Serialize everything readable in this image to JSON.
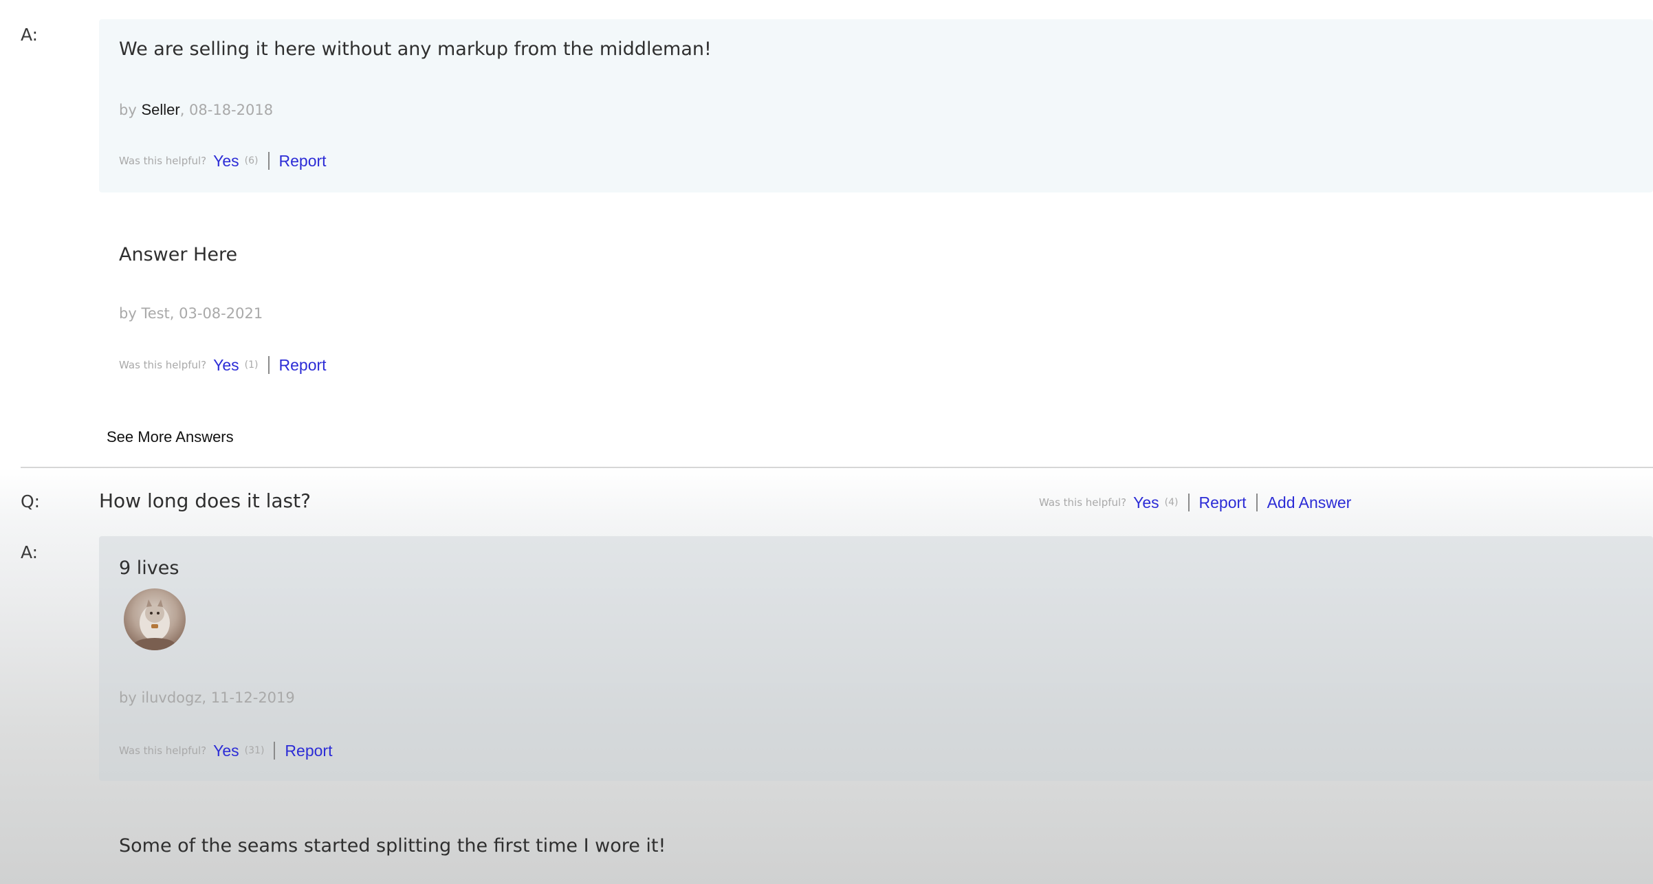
{
  "qa": {
    "first_block": {
      "answer_prefix": "A:",
      "answers": [
        {
          "text": "We are selling it here without any markup from the middleman!",
          "by_prefix": "by ",
          "author": "Seller",
          "date_suffix": ", 08-18-2018",
          "helpful_label": "Was this helpful?",
          "yes_label": "Yes",
          "yes_count": "(6)",
          "report_label": "Report"
        },
        {
          "text": "Answer Here",
          "by_prefix": "by ",
          "author": "Test",
          "date_suffix": ", 03-08-2021",
          "helpful_label": "Was this helpful?",
          "yes_label": "Yes",
          "yes_count": "(1)",
          "report_label": "Report"
        }
      ],
      "see_more_label": "See More Answers"
    },
    "second_block": {
      "question_prefix": "Q:",
      "question_text": "How long does it last?",
      "question_helpful_label": "Was this helpful?",
      "question_yes_label": "Yes",
      "question_yes_count": "(4)",
      "question_report_label": "Report",
      "add_answer_label": "Add Answer",
      "answer_prefix": "A:",
      "answers": [
        {
          "text": "9 lives",
          "has_image": true,
          "by_prefix": "by ",
          "author": "iluvdogz",
          "date_suffix": ", 11-12-2019",
          "helpful_label": "Was this helpful?",
          "yes_label": "Yes",
          "yes_count": "(31)",
          "report_label": "Report"
        },
        {
          "text": "Some of the seams started splitting the first time I wore it!"
        }
      ]
    }
  },
  "colors": {
    "link": "#2c2cd6",
    "muted": "#a9a9a9",
    "text": "#2f2f2f",
    "answer_box_light": "#f3f8fa"
  }
}
